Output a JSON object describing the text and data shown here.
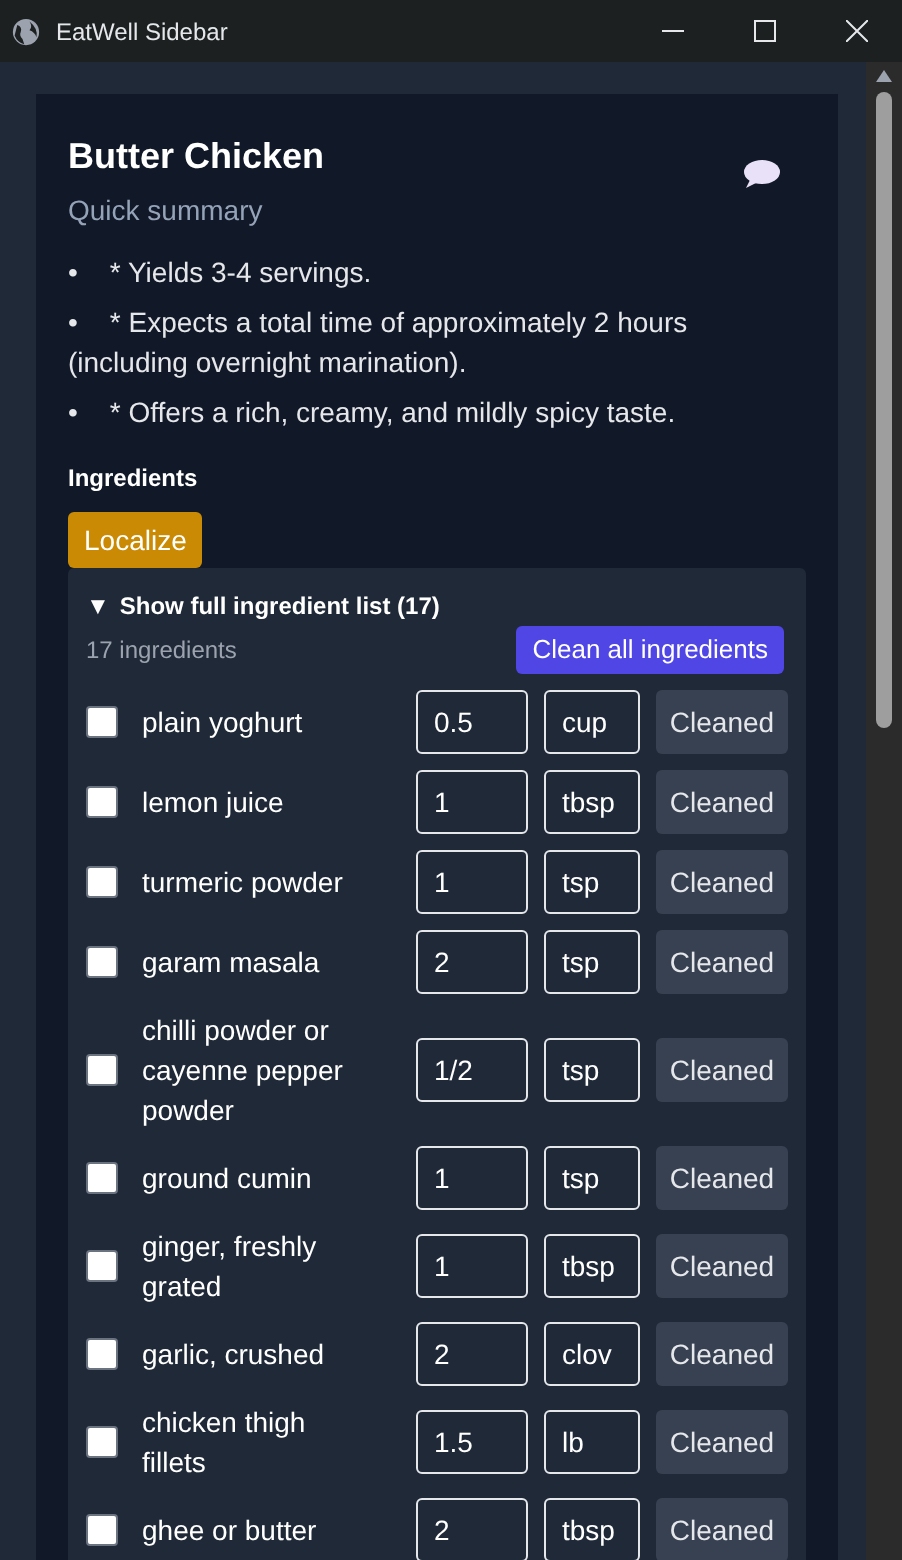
{
  "window": {
    "title": "EatWell Sidebar"
  },
  "recipe": {
    "title": "Butter Chicken",
    "subtitle": "Quick summary",
    "summary": [
      {
        "bullet": "•",
        "text": "* Yields 3-4 servings."
      },
      {
        "bullet": "•",
        "text": "* Expects a total time of approximately 2 hours (including overnight marination)."
      },
      {
        "bullet": "•",
        "text": "* Offers a rich, creamy, and mildly spicy taste."
      }
    ]
  },
  "ingredients": {
    "heading": "Ingredients",
    "localize_button": "Localize",
    "toggle": "▼",
    "toggle_label": "Show full ingredient list (17)",
    "count": "17 ingredients",
    "clean_all_button": "Clean all ingredients",
    "items": [
      {
        "name": "plain yoghurt",
        "quantity": "0.5",
        "unit": "cup",
        "checked": false,
        "action": "Cleaned"
      },
      {
        "name": "lemon juice",
        "quantity": "1",
        "unit": "tbsp",
        "checked": false,
        "action": "Cleaned"
      },
      {
        "name": "turmeric powder",
        "quantity": "1",
        "unit": "tsp",
        "checked": false,
        "action": "Cleaned"
      },
      {
        "name": "garam masala",
        "quantity": "2",
        "unit": "tsp",
        "checked": false,
        "action": "Cleaned"
      },
      {
        "name": "chilli powder or cayenne pepper powder",
        "quantity": "1/2",
        "unit": "tsp",
        "checked": false,
        "action": "Cleaned"
      },
      {
        "name": "ground cumin",
        "quantity": "1",
        "unit": "tsp",
        "checked": false,
        "action": "Cleaned"
      },
      {
        "name": "ginger, freshly grated",
        "quantity": "1",
        "unit": "tbsp",
        "checked": false,
        "action": "Cleaned"
      },
      {
        "name": "garlic, crushed",
        "quantity": "2",
        "unit": "clov",
        "checked": false,
        "action": "Cleaned"
      },
      {
        "name": "chicken thigh fillets",
        "quantity": "1.5",
        "unit": "lb",
        "checked": false,
        "action": "Cleaned"
      },
      {
        "name": "ghee or butter",
        "quantity": "2",
        "unit": "tbsp",
        "checked": false,
        "action": "Cleaned"
      }
    ]
  }
}
